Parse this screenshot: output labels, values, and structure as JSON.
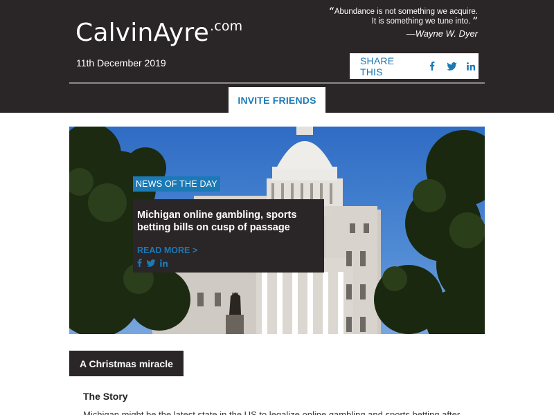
{
  "header": {
    "logo_main": "CalvinAyre",
    "logo_suffix": ".com",
    "quote_open": "“",
    "quote_line1": "Abundance is not something we acquire.",
    "quote_line2": "It is something we tune into.",
    "quote_close": "”",
    "quote_author": "—Wayne W. Dyer",
    "date": "11th December 2019",
    "share_label": "SHARE THIS",
    "share_icons": [
      "facebook-icon",
      "twitter-icon",
      "linkedin-icon"
    ],
    "invite_label": "INVITE FRIENDS"
  },
  "hero": {
    "tag": "NEWS OF THE DAY",
    "title": "Michigan online gambling, sports betting bills on cusp of passage",
    "read_more": "READ MORE >",
    "icons": [
      "facebook-icon",
      "twitter-icon",
      "linkedin-icon"
    ]
  },
  "section": {
    "tab_label": "A Christmas miracle",
    "story_heading": "The Story",
    "story_body": "Michigan might be the latest state in the US to legalize online gambling and sports betting after"
  },
  "colors": {
    "header_bg": "#2a2526",
    "accent_blue": "#1b79b6",
    "white": "#ffffff"
  }
}
